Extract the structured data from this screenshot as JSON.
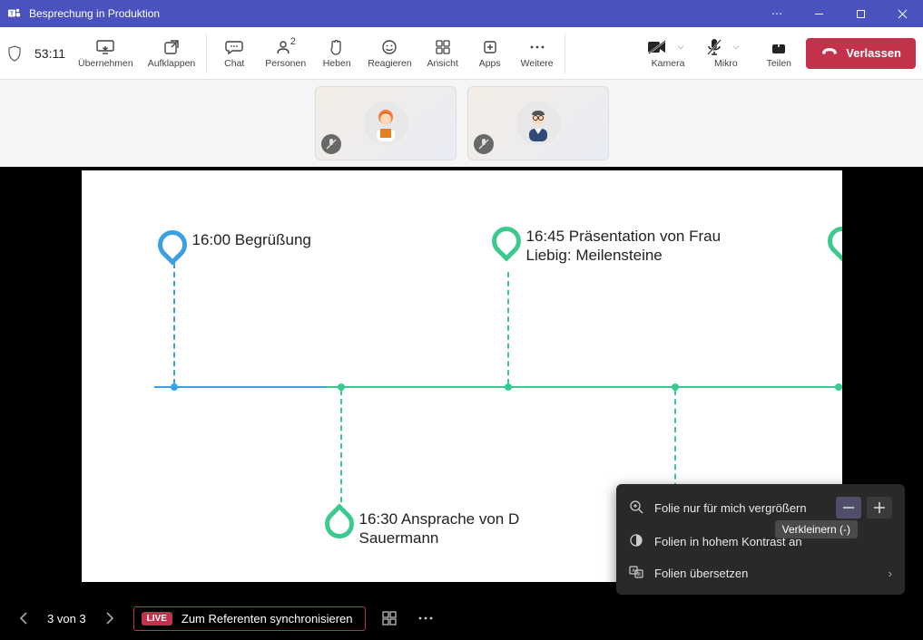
{
  "title": "Besprechung in Produktion",
  "timer": "53:11",
  "toolbar": {
    "takeover": "Übernehmen",
    "popout": "Aufklappen",
    "chat": "Chat",
    "people": "Personen",
    "people_count": "2",
    "raise": "Heben",
    "react": "Reagieren",
    "view": "Ansicht",
    "apps": "Apps",
    "more": "Weitere",
    "camera": "Kamera",
    "mic": "Mikro",
    "share": "Teilen",
    "leave": "Verlassen"
  },
  "slide": {
    "events": {
      "e1": {
        "time_label": "16:00 Begrüßung"
      },
      "e2": {
        "time_label": "16:45 Präsentation von Frau Liebig: Meilensteine"
      },
      "e3": {
        "time_label": "16:30 Ansprache von D     Sauermann"
      }
    }
  },
  "popup": {
    "zoom": "Folie nur für mich vergrößern",
    "contrast": "Folien in hohem Kontrast an",
    "translate": "Folien übersetzen",
    "zoom_tooltip": "Verkleinern (-)"
  },
  "bottom": {
    "counter": "3 von 3",
    "live": "LIVE",
    "sync": "Zum Referenten synchronisieren"
  }
}
